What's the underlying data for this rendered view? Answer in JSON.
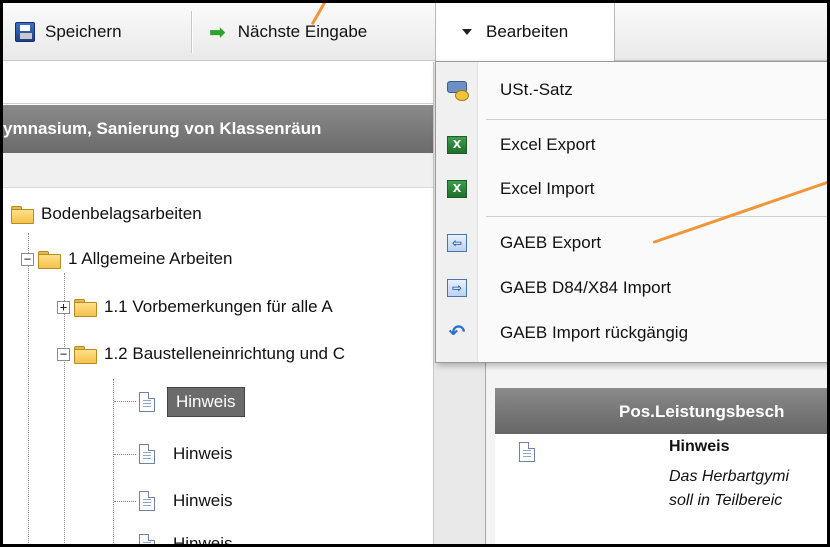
{
  "toolbar": {
    "save_label": "Speichern",
    "next_entry_label": "Nächste Eingabe",
    "edit_menu_label": "Bearbeiten"
  },
  "project_header": "ymnasium, Sanierung von Klassenräun",
  "tree": {
    "root": "Bodenbelagsarbeiten",
    "node_1": "1 Allgemeine Arbeiten",
    "node_1_1": "1.1 Vorbemerkungen für alle A",
    "node_1_2": "1.2 Baustelleneinrichtung und C",
    "leaves": [
      "Hinweis",
      "Hinweis",
      "Hinweis",
      "Hinweis"
    ]
  },
  "menu": {
    "ust": "USt.-Satz",
    "excel_export": "Excel Export",
    "excel_import": "Excel Import",
    "gaeb_export": "GAEB Export",
    "gaeb_import": "GAEB D84/X84 Import",
    "gaeb_undo": "GAEB Import rückgängig"
  },
  "table": {
    "col_pos": "Pos.",
    "col_desc": "Leistungsbesch",
    "row_title": "Hinweis",
    "row_text_1": "Das Herbartgymi",
    "row_text_2": "soll in Teilbereic"
  },
  "colors": {
    "annotation": "#f0963a",
    "header_gray": "#6b6b6b",
    "selection": "#6b6b6b"
  }
}
